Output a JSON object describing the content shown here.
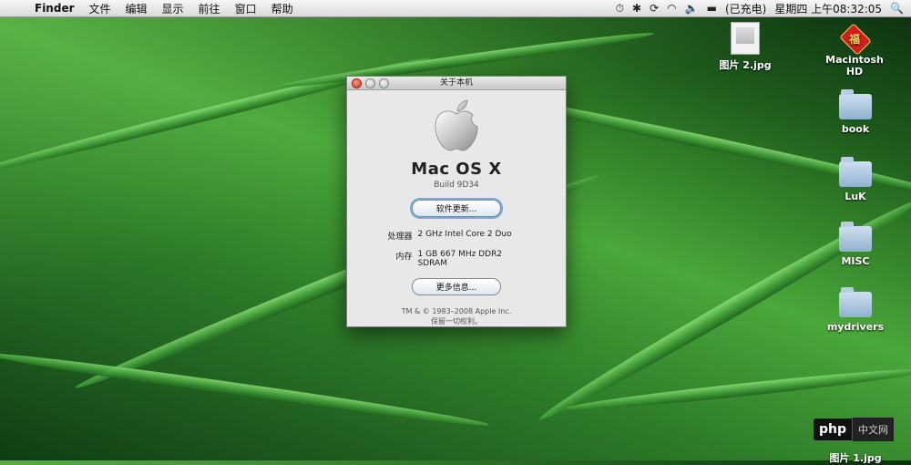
{
  "menubar": {
    "apple_glyph": "",
    "app_name": "Finder",
    "menus": [
      "文件",
      "编辑",
      "显示",
      "前往",
      "窗口",
      "帮助"
    ],
    "status": {
      "battery": "(已充电)",
      "clock": "星期四 上午08:32:05"
    },
    "glyphs": {
      "timemachine": "⏱",
      "bluetooth": "✱",
      "sync": "⟳",
      "wifi": "◠",
      "volume": "🔈",
      "flag": "▬",
      "spotlight": "🔍"
    }
  },
  "desktop": {
    "icons": [
      {
        "label": "图片 2.jpg",
        "type": "image-file"
      },
      {
        "label": "Macintosh HD",
        "type": "hard-drive"
      },
      {
        "label": "book",
        "type": "folder"
      },
      {
        "label": "LuK",
        "type": "folder"
      },
      {
        "label": "MISC",
        "type": "folder"
      },
      {
        "label": "mydrivers",
        "type": "folder"
      },
      {
        "label": "图片 1.jpg",
        "type": "image-file"
      }
    ]
  },
  "about_window": {
    "title": "关于本机",
    "os_name": "Mac OS X",
    "build": "Build 9D34",
    "update_button": "软件更新...",
    "processor_label": "处理器",
    "processor_value": "2 GHz Intel Core 2 Duo",
    "memory_label": "内存",
    "memory_value": "1 GB 667 MHz DDR2 SDRAM",
    "more_info_button": "更多信息...",
    "copyright": "TM & © 1983–2008 Apple Inc.",
    "rights": "保留一切权利。"
  },
  "watermark": {
    "part1": "php",
    "part2": "中文网"
  }
}
